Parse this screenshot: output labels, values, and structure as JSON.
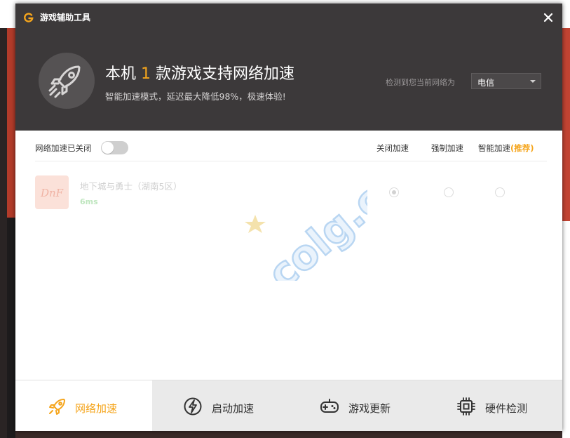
{
  "window": {
    "title": "游戏辅助工具",
    "close_icon": "close-icon",
    "logo_icon": "g-logo-icon"
  },
  "header": {
    "headline_prefix": "本机 ",
    "headline_count": "1",
    "headline_suffix": " 款游戏支持网络加速",
    "subline": "智能加速模式，延迟最大降低98%，极速体验!",
    "network_label": "检测到您当前网络为",
    "isp_selected": "电信",
    "rocket_icon": "rocket-icon"
  },
  "controls": {
    "toggle_label": "网络加速已关闭",
    "toggle_on": false,
    "columns": {
      "off": "关闭加速",
      "force": "强制加速",
      "smart": "智能加速",
      "smart_tag": "(推荐)"
    }
  },
  "games": [
    {
      "name": "地下城与勇士（湖南5区）",
      "ping": "6ms",
      "icon": "dnf-game-icon",
      "selected_mode": "off"
    }
  ],
  "bottom_nav": [
    {
      "label": "网络加速",
      "icon": "rocket-icon",
      "active": true
    },
    {
      "label": "启动加速",
      "icon": "lightning-icon",
      "active": false
    },
    {
      "label": "游戏更新",
      "icon": "gamepad-icon",
      "active": false
    },
    {
      "label": "硬件检测",
      "icon": "chip-icon",
      "active": false
    }
  ],
  "watermark_text": "colg.cn",
  "colors": {
    "accent": "#f5a51c",
    "header_bg": "#3c393a",
    "nav_bg": "#eaeaea"
  }
}
